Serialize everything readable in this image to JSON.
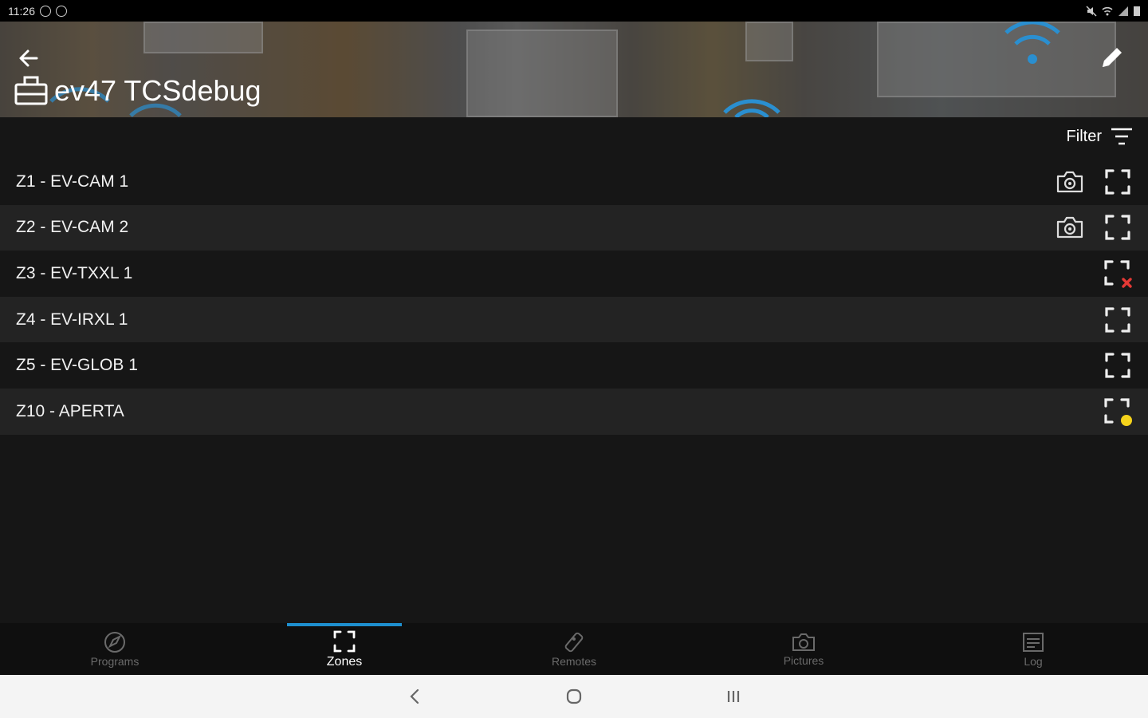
{
  "status_bar": {
    "time": "11:26"
  },
  "header": {
    "title": "ev47 TCSdebug"
  },
  "filter": {
    "label": "Filter"
  },
  "zones": [
    {
      "label": "Z1 - EV-CAM 1",
      "camera": true,
      "status": "normal"
    },
    {
      "label": "Z2 - EV-CAM 2",
      "camera": true,
      "status": "normal"
    },
    {
      "label": "Z3 - EV-TXXL 1",
      "camera": false,
      "status": "error"
    },
    {
      "label": "Z4 - EV-IRXL 1",
      "camera": false,
      "status": "normal"
    },
    {
      "label": "Z5 - EV-GLOB 1",
      "camera": false,
      "status": "normal"
    },
    {
      "label": "Z10 - APERTA",
      "camera": false,
      "status": "open"
    }
  ],
  "bottom_nav": {
    "items": [
      {
        "label": "Programs",
        "icon": "rocket-icon"
      },
      {
        "label": "Zones",
        "icon": "zone-icon"
      },
      {
        "label": "Remotes",
        "icon": "remote-icon"
      },
      {
        "label": "Pictures",
        "icon": "camera-icon"
      },
      {
        "label": "Log",
        "icon": "log-icon"
      }
    ],
    "active": "Zones"
  },
  "colors": {
    "accent": "#1e8fcf",
    "error": "#e53935",
    "open": "#f5d31b",
    "background": "#161616"
  }
}
